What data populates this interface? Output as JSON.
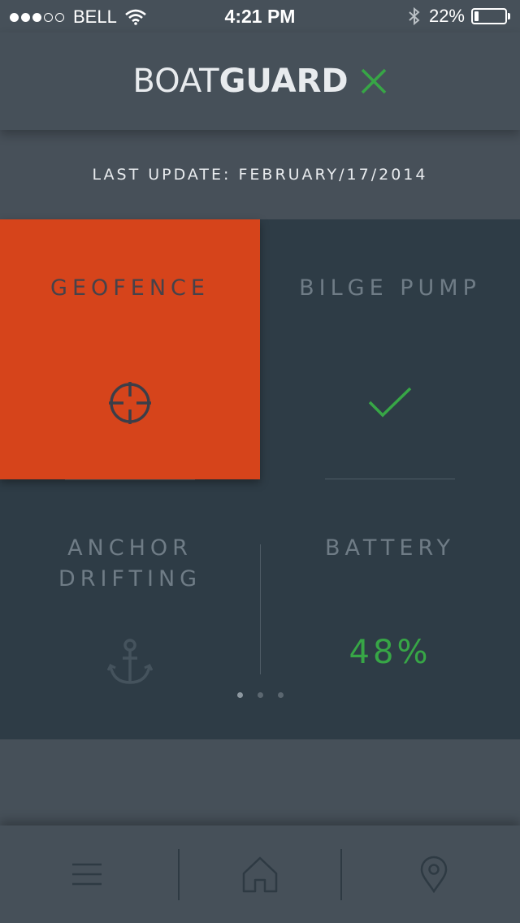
{
  "status_bar": {
    "signal_bars_full": 3,
    "signal_bars_total": 5,
    "carrier": "BELL",
    "time": "4:21 PM",
    "battery_percent_label": "22%",
    "battery_level": 0.22
  },
  "header": {
    "brand_light": "BOAT",
    "brand_bold": "GUARD",
    "logo_icon": "x-icon"
  },
  "update": {
    "label": "LAST UPDATE: FEBRUARY/17/2014"
  },
  "tiles": {
    "geofence": {
      "label": "GEOFENCE",
      "icon": "crosshair-icon"
    },
    "bilge": {
      "label": "BILGE PUMP",
      "icon": "checkmark-icon"
    },
    "anchor": {
      "label_line1": "ANCHOR",
      "label_line2": "DRIFTING",
      "icon": "anchor-icon"
    },
    "battery": {
      "label": "BATTERY",
      "value": "48%"
    }
  },
  "pager": {
    "count": 3,
    "active_index": 0
  },
  "tabbar": {
    "items": [
      {
        "icon": "menu-icon"
      },
      {
        "icon": "home-icon"
      },
      {
        "icon": "location-pin-icon"
      }
    ]
  },
  "colors": {
    "background": "#465059",
    "tile_dark": "#2e3c46",
    "geofence_alert": "#d6441b",
    "accent_green": "#37a646",
    "label_muted": "#6f7c86"
  }
}
